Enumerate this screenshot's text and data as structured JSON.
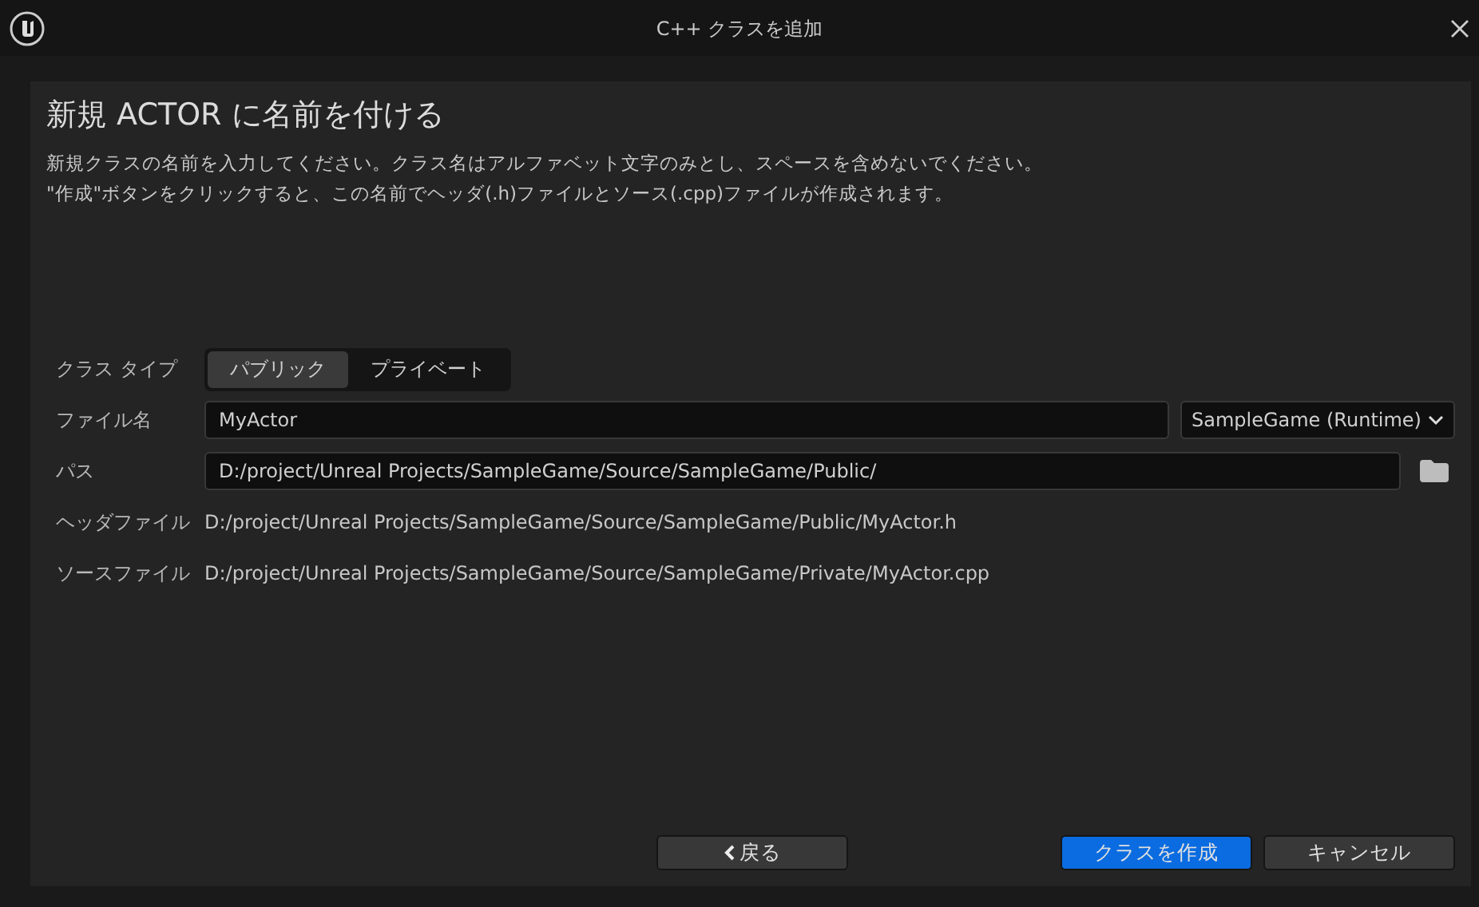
{
  "window": {
    "title": "C++ クラスを追加"
  },
  "heading": "新規 ACTOR に名前を付ける",
  "description": [
    "新規クラスの名前を入力してください。クラス名はアルファベット文字のみとし、スペースを含めないでください。",
    "\"作成\"ボタンをクリックすると、この名前でヘッダ(.h)ファイルとソース(.cpp)ファイルが作成されます。"
  ],
  "class_type": {
    "label": "クラス タイプ",
    "options": [
      {
        "label": "パブリック",
        "selected": true
      },
      {
        "label": "プライベート",
        "selected": false
      }
    ]
  },
  "file_name": {
    "label": "ファイル名",
    "value": "MyActor",
    "module": "SampleGame (Runtime)"
  },
  "path": {
    "label": "パス",
    "value": "D:/project/Unreal Projects/SampleGame/Source/SampleGame/Public/"
  },
  "header_file": {
    "label": "ヘッダファイル",
    "value": "D:/project/Unreal Projects/SampleGame/Source/SampleGame/Public/MyActor.h"
  },
  "source_file": {
    "label": "ソースファイル",
    "value": "D:/project/Unreal Projects/SampleGame/Source/SampleGame/Private/MyActor.cpp"
  },
  "buttons": [
    {
      "kind": "back",
      "label": "戻る"
    },
    {
      "kind": "primary",
      "label": "クラスを作成"
    },
    {
      "kind": "normal",
      "label": "キャンセル"
    }
  ]
}
